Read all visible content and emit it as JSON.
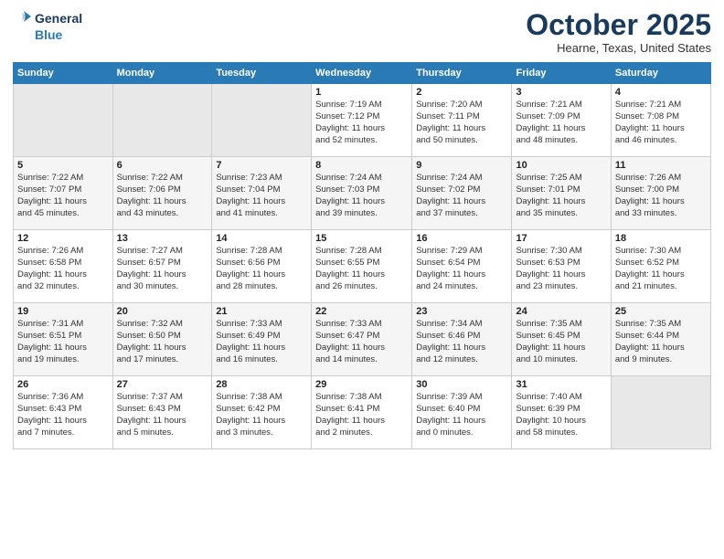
{
  "logo": {
    "line1": "General",
    "line2": "Blue"
  },
  "title": "October 2025",
  "location": "Hearne, Texas, United States",
  "weekdays": [
    "Sunday",
    "Monday",
    "Tuesday",
    "Wednesday",
    "Thursday",
    "Friday",
    "Saturday"
  ],
  "weeks": [
    [
      {
        "day": "",
        "info": ""
      },
      {
        "day": "",
        "info": ""
      },
      {
        "day": "",
        "info": ""
      },
      {
        "day": "1",
        "info": "Sunrise: 7:19 AM\nSunset: 7:12 PM\nDaylight: 11 hours\nand 52 minutes."
      },
      {
        "day": "2",
        "info": "Sunrise: 7:20 AM\nSunset: 7:11 PM\nDaylight: 11 hours\nand 50 minutes."
      },
      {
        "day": "3",
        "info": "Sunrise: 7:21 AM\nSunset: 7:09 PM\nDaylight: 11 hours\nand 48 minutes."
      },
      {
        "day": "4",
        "info": "Sunrise: 7:21 AM\nSunset: 7:08 PM\nDaylight: 11 hours\nand 46 minutes."
      }
    ],
    [
      {
        "day": "5",
        "info": "Sunrise: 7:22 AM\nSunset: 7:07 PM\nDaylight: 11 hours\nand 45 minutes."
      },
      {
        "day": "6",
        "info": "Sunrise: 7:22 AM\nSunset: 7:06 PM\nDaylight: 11 hours\nand 43 minutes."
      },
      {
        "day": "7",
        "info": "Sunrise: 7:23 AM\nSunset: 7:04 PM\nDaylight: 11 hours\nand 41 minutes."
      },
      {
        "day": "8",
        "info": "Sunrise: 7:24 AM\nSunset: 7:03 PM\nDaylight: 11 hours\nand 39 minutes."
      },
      {
        "day": "9",
        "info": "Sunrise: 7:24 AM\nSunset: 7:02 PM\nDaylight: 11 hours\nand 37 minutes."
      },
      {
        "day": "10",
        "info": "Sunrise: 7:25 AM\nSunset: 7:01 PM\nDaylight: 11 hours\nand 35 minutes."
      },
      {
        "day": "11",
        "info": "Sunrise: 7:26 AM\nSunset: 7:00 PM\nDaylight: 11 hours\nand 33 minutes."
      }
    ],
    [
      {
        "day": "12",
        "info": "Sunrise: 7:26 AM\nSunset: 6:58 PM\nDaylight: 11 hours\nand 32 minutes."
      },
      {
        "day": "13",
        "info": "Sunrise: 7:27 AM\nSunset: 6:57 PM\nDaylight: 11 hours\nand 30 minutes."
      },
      {
        "day": "14",
        "info": "Sunrise: 7:28 AM\nSunset: 6:56 PM\nDaylight: 11 hours\nand 28 minutes."
      },
      {
        "day": "15",
        "info": "Sunrise: 7:28 AM\nSunset: 6:55 PM\nDaylight: 11 hours\nand 26 minutes."
      },
      {
        "day": "16",
        "info": "Sunrise: 7:29 AM\nSunset: 6:54 PM\nDaylight: 11 hours\nand 24 minutes."
      },
      {
        "day": "17",
        "info": "Sunrise: 7:30 AM\nSunset: 6:53 PM\nDaylight: 11 hours\nand 23 minutes."
      },
      {
        "day": "18",
        "info": "Sunrise: 7:30 AM\nSunset: 6:52 PM\nDaylight: 11 hours\nand 21 minutes."
      }
    ],
    [
      {
        "day": "19",
        "info": "Sunrise: 7:31 AM\nSunset: 6:51 PM\nDaylight: 11 hours\nand 19 minutes."
      },
      {
        "day": "20",
        "info": "Sunrise: 7:32 AM\nSunset: 6:50 PM\nDaylight: 11 hours\nand 17 minutes."
      },
      {
        "day": "21",
        "info": "Sunrise: 7:33 AM\nSunset: 6:49 PM\nDaylight: 11 hours\nand 16 minutes."
      },
      {
        "day": "22",
        "info": "Sunrise: 7:33 AM\nSunset: 6:47 PM\nDaylight: 11 hours\nand 14 minutes."
      },
      {
        "day": "23",
        "info": "Sunrise: 7:34 AM\nSunset: 6:46 PM\nDaylight: 11 hours\nand 12 minutes."
      },
      {
        "day": "24",
        "info": "Sunrise: 7:35 AM\nSunset: 6:45 PM\nDaylight: 11 hours\nand 10 minutes."
      },
      {
        "day": "25",
        "info": "Sunrise: 7:35 AM\nSunset: 6:44 PM\nDaylight: 11 hours\nand 9 minutes."
      }
    ],
    [
      {
        "day": "26",
        "info": "Sunrise: 7:36 AM\nSunset: 6:43 PM\nDaylight: 11 hours\nand 7 minutes."
      },
      {
        "day": "27",
        "info": "Sunrise: 7:37 AM\nSunset: 6:43 PM\nDaylight: 11 hours\nand 5 minutes."
      },
      {
        "day": "28",
        "info": "Sunrise: 7:38 AM\nSunset: 6:42 PM\nDaylight: 11 hours\nand 3 minutes."
      },
      {
        "day": "29",
        "info": "Sunrise: 7:38 AM\nSunset: 6:41 PM\nDaylight: 11 hours\nand 2 minutes."
      },
      {
        "day": "30",
        "info": "Sunrise: 7:39 AM\nSunset: 6:40 PM\nDaylight: 11 hours\nand 0 minutes."
      },
      {
        "day": "31",
        "info": "Sunrise: 7:40 AM\nSunset: 6:39 PM\nDaylight: 10 hours\nand 58 minutes."
      },
      {
        "day": "",
        "info": ""
      }
    ]
  ]
}
